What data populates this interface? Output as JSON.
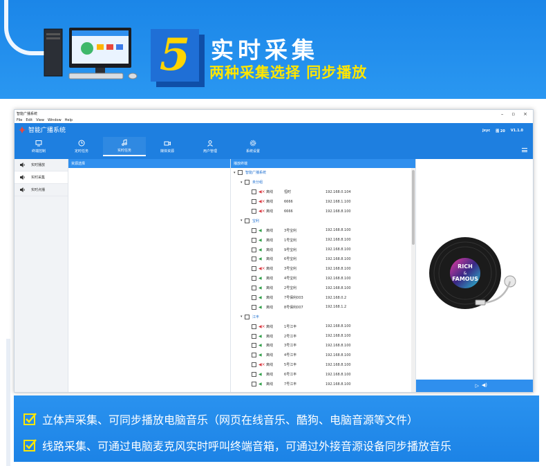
{
  "hero": {
    "number": "5",
    "title": "实时采集",
    "subtitle": "两种采集选择 同步播放"
  },
  "window": {
    "title": "智能广播系统",
    "menu": [
      "File",
      "Edit",
      "View",
      "Window",
      "Help"
    ],
    "brand": "智能广播系统",
    "user": "jxyc",
    "badge": "图 20",
    "version": "V1.1.0",
    "nav": [
      {
        "label": "终端控制",
        "icon": "monitor-icon"
      },
      {
        "label": "定时任务",
        "icon": "clock-icon"
      },
      {
        "label": "实时任务",
        "icon": "music-note-icon",
        "active": true
      },
      {
        "label": "媒体资源",
        "icon": "video-icon"
      },
      {
        "label": "用户管理",
        "icon": "user-icon"
      },
      {
        "label": "系统设置",
        "icon": "gear-icon"
      }
    ],
    "sidebar": [
      {
        "label": "实时播放"
      },
      {
        "label": "实时采集",
        "active": true
      },
      {
        "label": "实时点播"
      }
    ],
    "col1_header": "资源选择",
    "col2_header": "播放终端",
    "tree": {
      "root": "智能广播系统",
      "groups": [
        {
          "name": "未分组",
          "devices": [
            {
              "status": "离线",
              "name": "恒时",
              "ip": "192.168.0.104",
              "online": false
            },
            {
              "status": "离线",
              "name": "6666",
              "ip": "192.168.1.100",
              "online": false
            },
            {
              "status": "离线",
              "name": "6666",
              "ip": "192.168.8.100",
              "online": false
            }
          ]
        },
        {
          "name": "宝利",
          "devices": [
            {
              "status": "离线",
              "name": "3号宝利",
              "ip": "192.168.8.100",
              "online": true
            },
            {
              "status": "离线",
              "name": "1号宝利",
              "ip": "192.168.8.100",
              "online": true
            },
            {
              "status": "离线",
              "name": "9号宝利",
              "ip": "192.168.8.100",
              "online": true
            },
            {
              "status": "离线",
              "name": "6号宝利",
              "ip": "192.168.8.100",
              "online": true
            },
            {
              "status": "离线",
              "name": "3号宝利",
              "ip": "192.168.8.100",
              "online": false
            },
            {
              "status": "离线",
              "name": "4号宝利",
              "ip": "192.168.8.100",
              "online": true
            },
            {
              "status": "离线",
              "name": "2号宝利",
              "ip": "192.168.8.100",
              "online": true
            },
            {
              "status": "离线",
              "name": "7号保利003",
              "ip": "192.168.0.2",
              "online": true
            },
            {
              "status": "离线",
              "name": "8号保利007",
              "ip": "192.168.1.2",
              "online": true
            }
          ]
        },
        {
          "name": "江丰",
          "devices": [
            {
              "status": "离线",
              "name": "1号江丰",
              "ip": "192.168.8.100",
              "online": false
            },
            {
              "status": "离线",
              "name": "2号江丰",
              "ip": "192.168.8.100",
              "online": true
            },
            {
              "status": "离线",
              "name": "3号江丰",
              "ip": "192.168.8.100",
              "online": true
            },
            {
              "status": "离线",
              "name": "4号江丰",
              "ip": "192.168.8.100",
              "online": true
            },
            {
              "status": "离线",
              "name": "5号江丰",
              "ip": "192.168.8.100",
              "online": false
            },
            {
              "status": "离线",
              "name": "6号江丰",
              "ip": "192.168.8.100",
              "online": true
            },
            {
              "status": "离线",
              "name": "7号江丰",
              "ip": "192.168.8.100",
              "online": true
            }
          ]
        }
      ]
    },
    "record": {
      "line1": "RICH",
      "line2": "&",
      "line3": "FAMOUS"
    }
  },
  "features": [
    "立体声采集、可同步播放电脑音乐（网页在线音乐、酷狗、电脑音源等文件）",
    "线路采集、可通过电脑麦克风实时呼叫终端音箱，可通过外接音源设备同步播放音乐"
  ],
  "colors": {
    "primary": "#1e7fe0",
    "accent": "#ffe600",
    "offline": "#d9363e",
    "online": "#2e9d46"
  }
}
